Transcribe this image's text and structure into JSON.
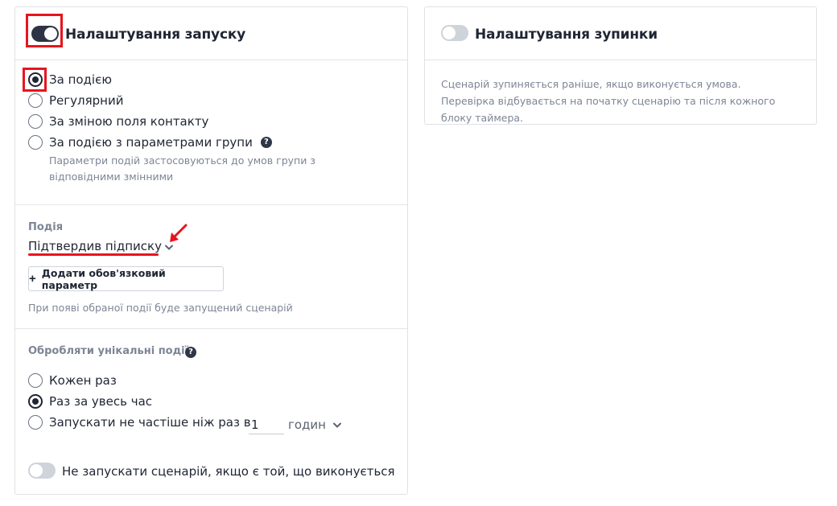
{
  "start_card": {
    "title": "Налаштування запуску",
    "toggle_on": true,
    "trigger_options": [
      {
        "label": "За подією",
        "checked": true
      },
      {
        "label": "Регулярний",
        "checked": false
      },
      {
        "label": "За зміною поля контакту",
        "checked": false
      },
      {
        "label": "За подією з параметрами групи",
        "checked": false
      }
    ],
    "group_params_hint": "Параметри подій застосовуються до умов групи з відповідними змінними",
    "event": {
      "label": "Подія",
      "value": "Підтвердив підписку",
      "add_param_button": "Додати обов'язковий параметр",
      "hint": "При появі обраної події буде запущений сценарій"
    },
    "unique_events": {
      "label": "Обробляти унікальні події:",
      "options": [
        {
          "label": "Кожен раз",
          "checked": false
        },
        {
          "label": "Раз за увесь час",
          "checked": true
        },
        {
          "label": "Запускати не частіше ніж раз в",
          "checked": false
        }
      ],
      "interval_value": "1",
      "interval_unit": "годин"
    },
    "no_rerun_toggle_on": false,
    "no_rerun_label": "Не запускати сценарій, якщо є той, що виконується"
  },
  "stop_card": {
    "title": "Налаштування зупинки",
    "toggle_on": false,
    "description": "Сценарій зупиняється раніше, якщо виконується умова. Перевірка відбувається на початку сценарію та після кожного блоку таймера."
  },
  "icons": {
    "help": "question-circle-icon",
    "chevron": "chevron-down-icon",
    "plus": "plus-icon",
    "annotation_arrow": "red-arrow-icon"
  },
  "colors": {
    "toggle_on": "#2c3444",
    "toggle_off": "#cfd3da",
    "annotation_red": "#e8141e",
    "hint_text": "#7d8595"
  }
}
